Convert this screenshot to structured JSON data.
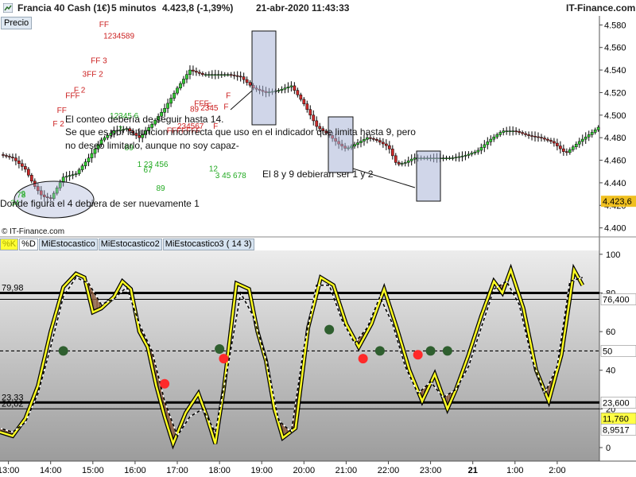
{
  "title": {
    "instrument": "Francia 40 Cash (1€)",
    "timeframe": "5 minutos",
    "last": "4.423,8 (-1,39%)",
    "datetime": "21-abr-2020 11:43:33",
    "brand": "IT-Finance.com"
  },
  "price_panel_button": "Precio",
  "copyright": "© IT-Finance.com",
  "indicator_tabs": [
    "%K",
    "%D",
    "MiEstocastico",
    "MiEstocastico2",
    "MiEstocastico3 ( 14 3)"
  ],
  "annotations": {
    "note1": "El conteo debería de seguir hasta 14.",
    "note2": "Se que es por la funcion incorrecta que uso en el indicador que limita hasta 9, pero",
    "note3": "no deseo limitarlo, aunque no soy capaz-",
    "note4": "El 8 y 9 debieran ser 1 y 2",
    "note5": "Donde figura el 4 debiera de ser nuevamente 1"
  },
  "chart_data": [
    {
      "type": "candlestick",
      "price_ticks": [
        "4.580",
        "4.560",
        "4.540",
        "4.520",
        "4.500",
        "4.480",
        "4.460",
        "4.440",
        "4.420",
        "4.400"
      ],
      "ylim": [
        4392,
        4588
      ],
      "current_price": "4.423,6",
      "time_ticks": [
        "13:00",
        "14:00",
        "15:00",
        "16:00",
        "17:00",
        "18:00",
        "19:00",
        "20:00",
        "21:00",
        "22:00",
        "23:00",
        "21",
        "1:00",
        "2:00"
      ],
      "close_path": [
        [
          0,
          4465
        ],
        [
          3,
          4462
        ],
        [
          6,
          4452
        ],
        [
          8,
          4438
        ],
        [
          10,
          4428
        ],
        [
          12,
          4426
        ],
        [
          15,
          4445
        ],
        [
          18,
          4448
        ],
        [
          21,
          4462
        ],
        [
          24,
          4478
        ],
        [
          27,
          4486
        ],
        [
          30,
          4488
        ],
        [
          33,
          4480
        ],
        [
          36,
          4492
        ],
        [
          39,
          4506
        ],
        [
          42,
          4524
        ],
        [
          45,
          4540
        ],
        [
          48,
          4536
        ],
        [
          51,
          4536
        ],
        [
          54,
          4536
        ],
        [
          57,
          4534
        ],
        [
          60,
          4524
        ],
        [
          63,
          4520
        ],
        [
          66,
          4522
        ],
        [
          69,
          4526
        ],
        [
          72,
          4510
        ],
        [
          75,
          4490
        ],
        [
          78,
          4482
        ],
        [
          80,
          4475
        ],
        [
          82,
          4470
        ],
        [
          84,
          4474
        ],
        [
          87,
          4480
        ],
        [
          89,
          4478
        ],
        [
          92,
          4472
        ],
        [
          94,
          4456
        ],
        [
          96,
          4458
        ],
        [
          98,
          4462
        ],
        [
          101,
          4462
        ],
        [
          104,
          4462
        ],
        [
          107,
          4462
        ],
        [
          110,
          4464
        ],
        [
          113,
          4468
        ],
        [
          116,
          4478
        ],
        [
          119,
          4486
        ],
        [
          122,
          4486
        ],
        [
          125,
          4482
        ],
        [
          128,
          4480
        ],
        [
          131,
          4476
        ],
        [
          134,
          4466
        ],
        [
          137,
          4476
        ],
        [
          140,
          4484
        ],
        [
          142,
          4490
        ]
      ],
      "count_labels_red": [
        {
          "time": 12.5,
          "price": 4490,
          "text": "F 2"
        },
        {
          "time": 13.5,
          "price": 4502,
          "text": "FF"
        },
        {
          "time": 15.5,
          "price": 4515,
          "text": "FFF"
        },
        {
          "time": 17.5,
          "price": 4520,
          "text": "F 2"
        },
        {
          "time": 19.5,
          "price": 4534,
          "text": "3FF 2"
        },
        {
          "time": 21.5,
          "price": 4546,
          "text": "FF 3"
        },
        {
          "time": 23.5,
          "price": 4578,
          "text": "FF"
        },
        {
          "time": 24.5,
          "price": 4568,
          "text": "1234589"
        },
        {
          "time": 39.5,
          "price": 4484,
          "text": "FFFFFFF"
        },
        {
          "time": 42.0,
          "price": 4488,
          "text": "234567"
        },
        {
          "time": 45.0,
          "price": 4503,
          "text": "89"
        },
        {
          "time": 46.0,
          "price": 4508,
          "text": "FFF"
        },
        {
          "time": 47.5,
          "price": 4504,
          "text": "2345"
        },
        {
          "time": 49.0,
          "price": 4506,
          "text": "F"
        },
        {
          "time": 50.5,
          "price": 4488,
          "text": "F"
        },
        {
          "time": 53.0,
          "price": 4505,
          "text": "F"
        },
        {
          "time": 53.5,
          "price": 4515,
          "text": "F"
        }
      ],
      "count_labels_green": [
        {
          "time": 2.5,
          "price": 4420,
          "text": "3"
        },
        {
          "time": 3.5,
          "price": 4420,
          "text": "4"
        },
        {
          "time": 4.0,
          "price": 4427,
          "text": "78"
        },
        {
          "time": 5.0,
          "price": 4428,
          "text": "9"
        },
        {
          "time": 26.0,
          "price": 4497,
          "text": "12345 6"
        },
        {
          "time": 28.0,
          "price": 4485,
          "text": "7"
        },
        {
          "time": 29.5,
          "price": 4469,
          "text": "89"
        },
        {
          "time": 32.5,
          "price": 4454,
          "text": "1 23 456"
        },
        {
          "time": 34.0,
          "price": 4449,
          "text": "67"
        },
        {
          "time": 37.0,
          "price": 4433,
          "text": "89"
        },
        {
          "time": 49.5,
          "price": 4450,
          "text": "12"
        },
        {
          "time": 51.0,
          "price": 4444,
          "text": "3 45 678"
        }
      ]
    },
    {
      "type": "line",
      "title": "MiEstocastico3 ( 14 3)",
      "ylim": [
        -7,
        102
      ],
      "yticks": [
        "100",
        "80",
        "60",
        "40",
        "20",
        "0"
      ],
      "levels": {
        "upper": 79.98,
        "lower": 23.33,
        "mid": 50
      },
      "level_labels": [
        "79,98",
        "23,33",
        "20,02"
      ],
      "right_labels": [
        "76,400",
        "50",
        "23,600",
        "11,760",
        "8,9517"
      ],
      "series": [
        {
          "name": "%K",
          "values": [
            [
              0,
              8
            ],
            [
              3,
              6
            ],
            [
              6,
              15
            ],
            [
              9,
              32
            ],
            [
              12,
              60
            ],
            [
              15,
              83
            ],
            [
              18,
              90
            ],
            [
              20,
              88
            ],
            [
              22,
              70
            ],
            [
              24,
              72
            ],
            [
              27,
              78
            ],
            [
              29,
              86
            ],
            [
              31,
              82
            ],
            [
              33,
              60
            ],
            [
              35,
              52
            ],
            [
              37,
              32
            ],
            [
              39,
              16
            ],
            [
              41,
              2
            ],
            [
              44,
              18
            ],
            [
              47,
              28
            ],
            [
              49,
              16
            ],
            [
              51,
              2
            ],
            [
              53,
              30
            ],
            [
              56,
              85
            ],
            [
              59,
              82
            ],
            [
              61,
              60
            ],
            [
              63,
              45
            ],
            [
              65,
              20
            ],
            [
              67,
              5
            ],
            [
              70,
              10
            ],
            [
              73,
              62
            ],
            [
              76,
              88
            ],
            [
              79,
              84
            ],
            [
              82,
              64
            ],
            [
              85,
              52
            ],
            [
              88,
              64
            ],
            [
              91,
              82
            ],
            [
              94,
              62
            ],
            [
              97,
              40
            ],
            [
              100,
              24
            ],
            [
              103,
              38
            ],
            [
              106,
              20
            ],
            [
              108,
              30
            ],
            [
              111,
              48
            ],
            [
              114,
              68
            ],
            [
              117,
              86
            ],
            [
              119,
              80
            ],
            [
              121,
              92
            ],
            [
              124,
              72
            ],
            [
              127,
              40
            ],
            [
              130,
              24
            ],
            [
              133,
              48
            ],
            [
              136,
              92
            ],
            [
              138,
              84
            ]
          ]
        },
        {
          "name": "%D",
          "values": [
            [
              0,
              10
            ],
            [
              3,
              8
            ],
            [
              6,
              13
            ],
            [
              9,
              28
            ],
            [
              12,
              52
            ],
            [
              15,
              78
            ],
            [
              18,
              88
            ],
            [
              21,
              85
            ],
            [
              24,
              74
            ],
            [
              27,
              77
            ],
            [
              30,
              83
            ],
            [
              33,
              64
            ],
            [
              36,
              50
            ],
            [
              39,
              24
            ],
            [
              42,
              6
            ],
            [
              45,
              16
            ],
            [
              48,
              20
            ],
            [
              51,
              8
            ],
            [
              54,
              42
            ],
            [
              57,
              80
            ],
            [
              60,
              68
            ],
            [
              63,
              46
            ],
            [
              66,
              14
            ],
            [
              69,
              8
            ],
            [
              72,
              52
            ],
            [
              75,
              84
            ],
            [
              78,
              84
            ],
            [
              81,
              66
            ],
            [
              84,
              54
            ],
            [
              87,
              62
            ],
            [
              90,
              78
            ],
            [
              93,
              64
            ],
            [
              96,
              42
            ],
            [
              99,
              28
            ],
            [
              102,
              34
            ],
            [
              105,
              26
            ],
            [
              108,
              30
            ],
            [
              111,
              42
            ],
            [
              114,
              62
            ],
            [
              117,
              82
            ],
            [
              120,
              86
            ],
            [
              123,
              74
            ],
            [
              126,
              46
            ],
            [
              129,
              28
            ],
            [
              132,
              42
            ],
            [
              135,
              86
            ],
            [
              138,
              88
            ]
          ]
        }
      ],
      "markers_green": [
        [
          15,
          50
        ],
        [
          52,
          51
        ],
        [
          78,
          61
        ],
        [
          90,
          50
        ],
        [
          102,
          50
        ],
        [
          106,
          50
        ]
      ],
      "markers_red": [
        [
          39,
          33
        ],
        [
          53,
          46
        ],
        [
          86,
          46
        ],
        [
          99,
          48
        ]
      ]
    }
  ]
}
